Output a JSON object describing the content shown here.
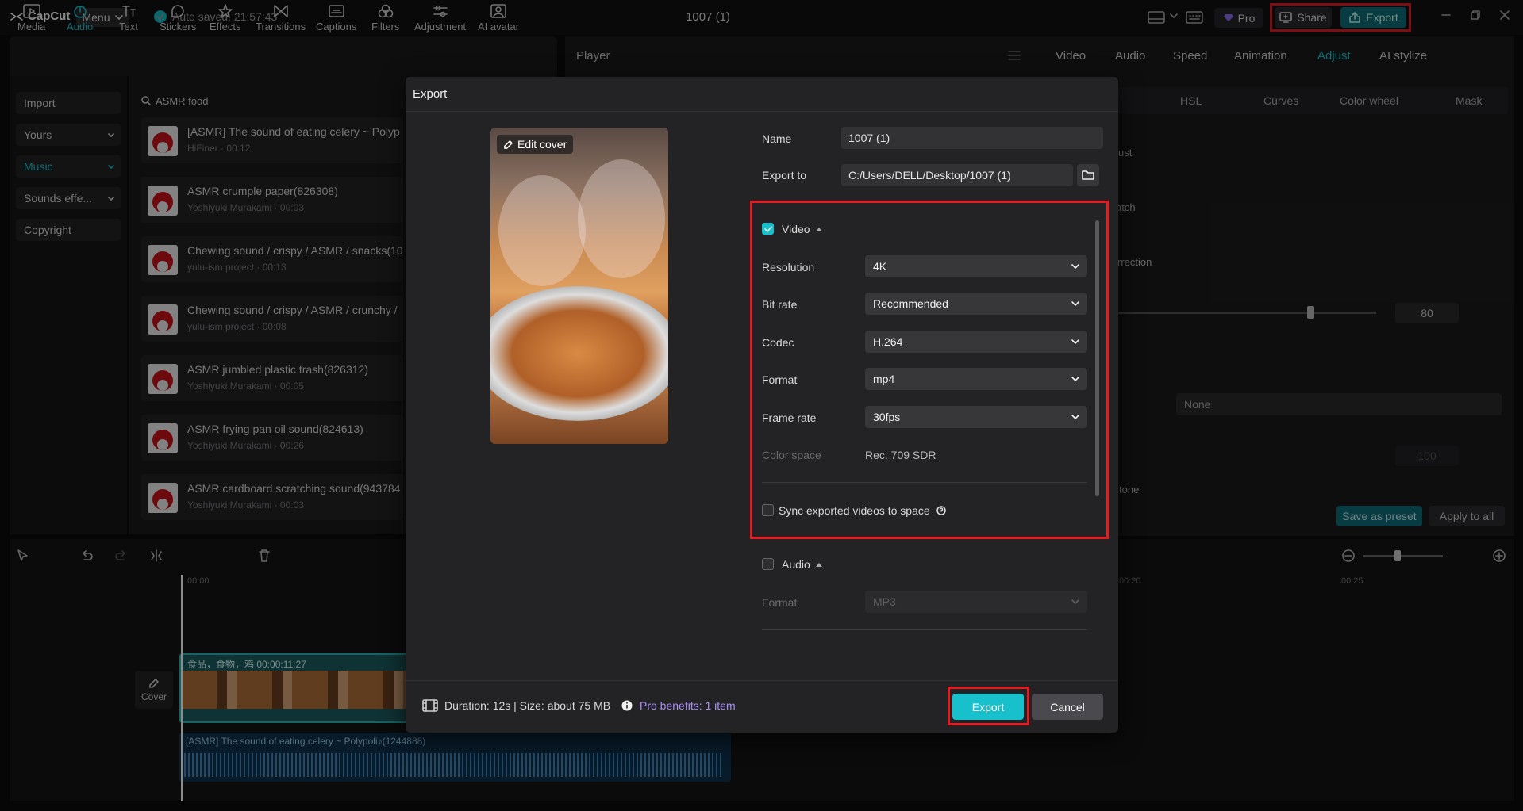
{
  "app": {
    "logo_text": "CapCut",
    "menu_label": "Menu",
    "autosave_text": "Auto saved: 21:57:43",
    "project_title": "1007 (1)",
    "pro_label": "Pro",
    "share_label": "Share",
    "export_label": "Export"
  },
  "toolbar": {
    "items": [
      {
        "label": "Media",
        "icon": "media-icon"
      },
      {
        "label": "Audio",
        "icon": "audio-icon",
        "active": true
      },
      {
        "label": "Text",
        "icon": "text-icon"
      },
      {
        "label": "Stickers",
        "icon": "stickers-icon"
      },
      {
        "label": "Effects",
        "icon": "effects-icon"
      },
      {
        "label": "Transitions",
        "icon": "transitions-icon"
      },
      {
        "label": "Captions",
        "icon": "captions-icon"
      },
      {
        "label": "Filters",
        "icon": "filters-icon"
      },
      {
        "label": "Adjustment",
        "icon": "adjustment-icon"
      },
      {
        "label": "AI avatar",
        "icon": "ai-avatar-icon"
      }
    ]
  },
  "left_nav": {
    "items": [
      "Import",
      "Yours",
      "Music",
      "Sounds effe...",
      "Copyright"
    ]
  },
  "audio_panel": {
    "search_value": "ASMR food",
    "sounds": [
      {
        "title": "[ASMR] The sound of eating celery ~ Polyp",
        "sub": "HiFiner · 00:12"
      },
      {
        "title": "ASMR crumple paper(826308)",
        "sub": "Yoshiyuki Murakami · 00:03"
      },
      {
        "title": "Chewing sound / crispy / ASMR / snacks(10",
        "sub": "yulu-ism project · 00:13"
      },
      {
        "title": "Chewing sound / crispy / ASMR / crunchy /",
        "sub": "yulu-ism project · 00:08"
      },
      {
        "title": "ASMR jumbled plastic trash(826312)",
        "sub": "Yoshiyuki Murakami · 00:05"
      },
      {
        "title": "ASMR frying pan oil sound(824613)",
        "sub": "Yoshiyuki Murakami · 00:26"
      },
      {
        "title": "ASMR cardboard scratching sound(943784",
        "sub": "Yoshiyuki Murakami · 00:03"
      }
    ]
  },
  "player": {
    "title": "Player"
  },
  "right_panel": {
    "tabs": [
      "Video",
      "Audio",
      "Speed",
      "Animation",
      "Adjust",
      "AI stylize"
    ],
    "active_tab": "Adjust",
    "subtabs": [
      "HSL",
      "Curves",
      "Color wheel",
      "Mask"
    ],
    "row1": "ust",
    "row2": "atch",
    "row3": "rrection",
    "slider_value": "80",
    "row5_value": "100",
    "select_value": "None",
    "row6": "tone",
    "save_preset": "Save as preset",
    "apply_all": "Apply to all"
  },
  "timeline": {
    "ruler": [
      "00:00",
      "00:20",
      "00:25"
    ],
    "clip_label": "食品，食物，鸡   00:00:11:27",
    "cover_label": "Cover",
    "audio_clip_label": "[ASMR] The sound of eating celery ~ Polypoli♪(1244888)"
  },
  "export_dialog": {
    "title": "Export",
    "edit_cover": "Edit cover",
    "name_label": "Name",
    "name_value": "1007 (1)",
    "export_to_label": "Export to",
    "export_to_value": "C:/Users/DELL/Desktop/1007 (1)",
    "video_section": {
      "label": "Video",
      "checked": true,
      "resolution_label": "Resolution",
      "resolution_value": "4K",
      "bitrate_label": "Bit rate",
      "bitrate_value": "Recommended",
      "codec_label": "Codec",
      "codec_value": "H.264",
      "format_label": "Format",
      "format_value": "mp4",
      "framerate_label": "Frame rate",
      "framerate_value": "30fps",
      "colorspace_label": "Color space",
      "colorspace_value": "Rec. 709 SDR",
      "sync_label": "Sync exported videos to space"
    },
    "audio_section": {
      "label": "Audio",
      "checked": false,
      "format_label": "Format",
      "format_value": "MP3"
    },
    "footer": {
      "duration_size": "Duration: 12s | Size: about 75 MB",
      "pro_benefits": "Pro benefits: 1 item",
      "export_button": "Export",
      "cancel_button": "Cancel"
    }
  },
  "colors": {
    "accent": "#18c0cc",
    "highlight_box": "#e31b23",
    "pro_text": "#a98cf5"
  }
}
